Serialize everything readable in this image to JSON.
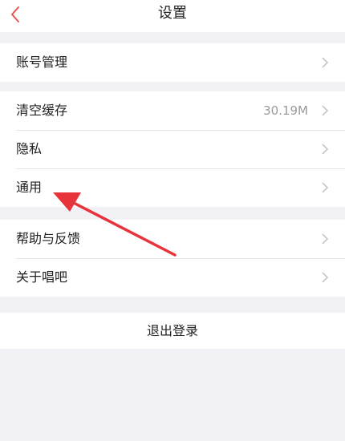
{
  "header": {
    "title": "设置"
  },
  "groups": [
    {
      "items": [
        {
          "label": "账号管理"
        }
      ]
    },
    {
      "items": [
        {
          "label": "清空缓存",
          "value": "30.19M"
        },
        {
          "label": "隐私"
        },
        {
          "label": "通用"
        }
      ]
    },
    {
      "items": [
        {
          "label": "帮助与反馈"
        },
        {
          "label": "关于唱吧"
        }
      ]
    }
  ],
  "logout_label": "退出登录",
  "colors": {
    "accent": "#e8534f",
    "annotation": "#e8333a"
  },
  "icons": {
    "back": "chevron-left-icon",
    "row": "chevron-right-icon"
  }
}
